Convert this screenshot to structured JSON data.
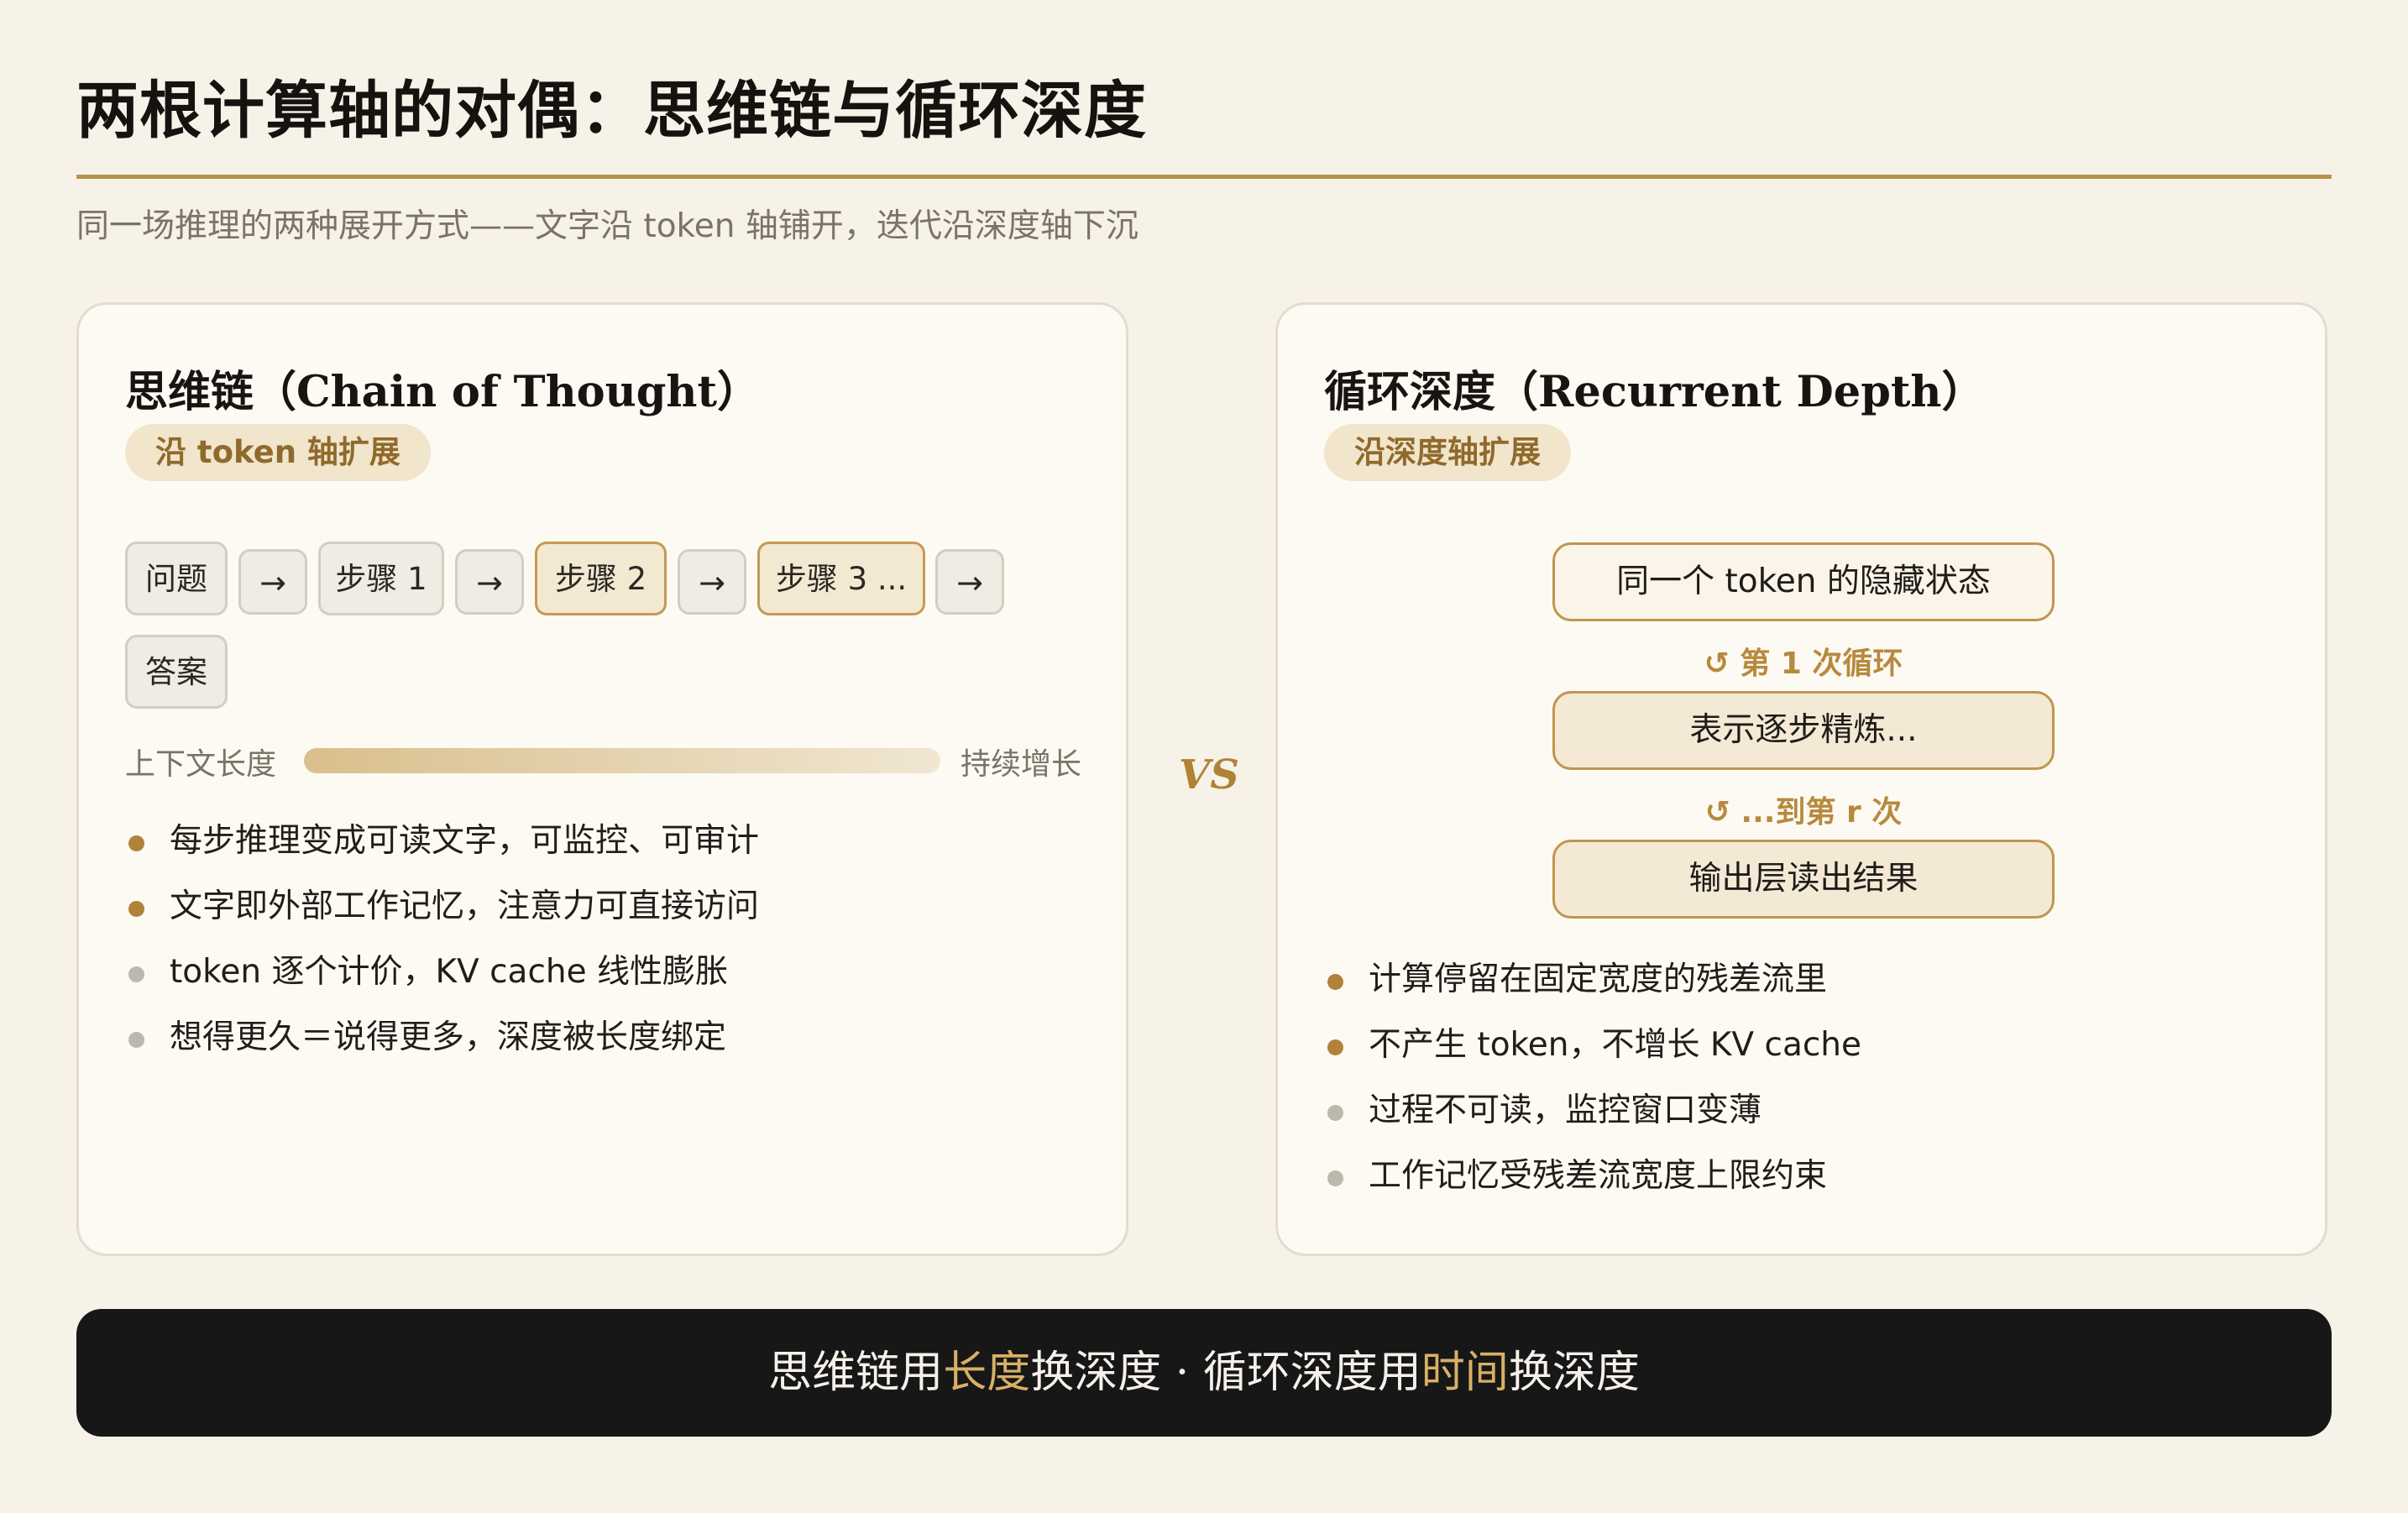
{
  "title": "两根计算轴的对偶：思维链与循环深度",
  "subtitle": "同一场推理的两种展开方式——文字沿 token 轴铺开，迭代沿深度轴下沉",
  "vs": "VS",
  "left": {
    "title": "思维链（Chain of Thought）",
    "pill": "沿 token 轴扩展",
    "chips": {
      "question": "问题",
      "step1": "步骤 1",
      "step2": "步骤 2",
      "step3": "步骤 3 ...",
      "answer": "答案",
      "arrow": "→"
    },
    "context_label": "上下文长度",
    "context_end": "持续增长",
    "bullets": [
      "每步推理变成可读文字，可监控、可审计",
      "文字即外部工作记忆，注意力可直接访问",
      "token 逐个计价，KV cache 线性膨胀",
      "想得更久＝说得更多，深度被长度绑定"
    ]
  },
  "right": {
    "title": "循环深度（Recurrent Depth）",
    "pill": "沿深度轴扩展",
    "box1": "同一个 token 的隐藏状态",
    "loop1": "第 1 次循环",
    "box2": "表示逐步精炼...",
    "loop2": "...到第 r 次",
    "box3": "输出层读出结果",
    "loop_icon": "↺",
    "bullets": [
      "计算停留在固定宽度的残差流里",
      "不产生 token，不增长 KV cache",
      "过程不可读，监控窗口变薄",
      "工作记忆受残差流宽度上限约束"
    ]
  },
  "banner": {
    "part1": "思维链用",
    "accent1": "长度",
    "part2": "换深度 · 循环深度用",
    "accent2": "时间",
    "part3": "换深度"
  },
  "colors": {
    "accent": "#b8914c",
    "background": "#f6f2e8",
    "banner": "#171717"
  }
}
